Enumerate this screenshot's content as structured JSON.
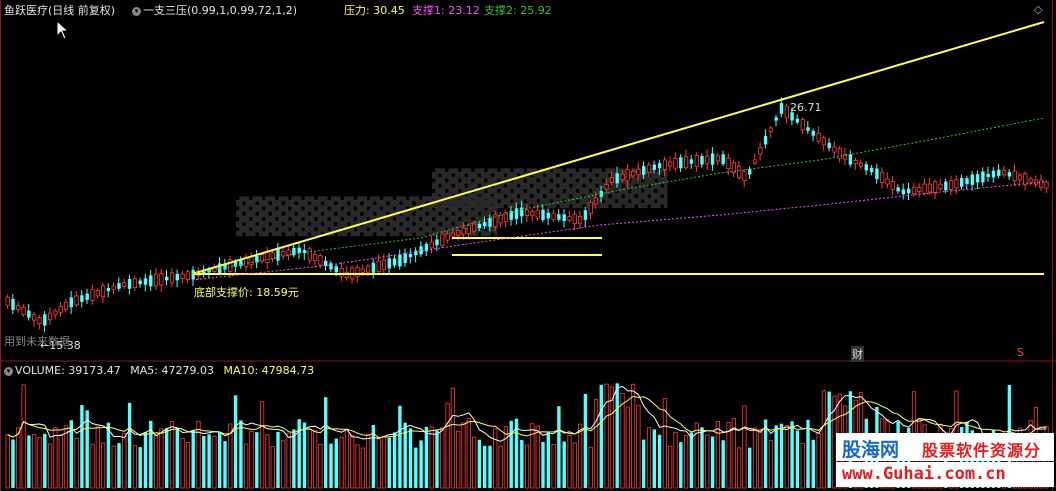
{
  "header": {
    "stock_name": "鱼跃医疗(日线 前复权)",
    "indicator": "一支三压(0.99,1,0.99,72,1,2)",
    "pressure_label": "压力: 30.45",
    "support1_label": "支撑1: 23.12",
    "support2_label": "支撑2: 25.92"
  },
  "annotations": {
    "peak_label": "26.71",
    "bottom_support": "底部支撑价: 18.59元",
    "low_label": "15.38",
    "future_data_hint": "用到未来数据",
    "finance_marker": "财",
    "dividend_marker": "S"
  },
  "volume_header": {
    "volume_label": "VOLUME: 39173.47",
    "ma5_label": "MA5: 47279.03",
    "ma10_label": "MA10: 47984.73"
  },
  "watermark": {
    "logo": "股海网",
    "slogan": "股票软件资源分享",
    "url": "www.Guhai.com.cn"
  },
  "colors": {
    "up": "#ff3c3c",
    "down": "#54ffff",
    "yellow": "#ffff55",
    "magenta": "#ff50ff",
    "green": "#35c535"
  },
  "chart_data": {
    "type": "candlestick",
    "price_levels": {
      "pressure": 30.45,
      "support1": 23.12,
      "support2": 25.92,
      "bottom_support": 18.59,
      "peak": 26.71,
      "low": 15.38
    },
    "volume": {
      "last": 39173.47,
      "ma5": 47279.03,
      "ma10": 47984.73
    }
  }
}
